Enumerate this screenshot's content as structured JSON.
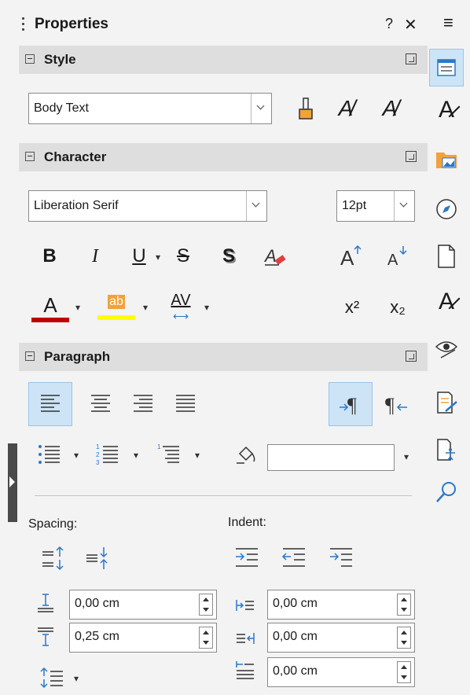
{
  "panel": {
    "title": "Properties",
    "help_label": "?",
    "close_label": "✕",
    "menu_label": "≡"
  },
  "style": {
    "header": "Style",
    "paragraph_style": "Body Text"
  },
  "character": {
    "header": "Character",
    "font_name": "Liberation Serif",
    "font_size": "12pt",
    "bold_label": "B",
    "italic_label": "I",
    "underline_label": "U",
    "strike_label": "S",
    "shadow_label": "S",
    "superscript_label": "x²",
    "subscript_label": "x₂",
    "font_color_label": "A",
    "highlight_label": "ab",
    "spacing_label": "AV",
    "font_color": "#c00000",
    "highlight_color": "#ffff00"
  },
  "paragraph": {
    "header": "Paragraph",
    "spacing_label": "Spacing:",
    "indent_label": "Indent:",
    "above_spacing": "0,00 cm",
    "below_spacing": "0,25 cm",
    "before_indent": "0,00 cm",
    "after_indent": "0,00 cm",
    "first_line_indent": "0,00 cm",
    "list_style": ""
  },
  "colors": {
    "accent": "#2a78c8",
    "selected_bg": "#cde4f7",
    "header_bg": "#dedede",
    "panel_bg": "#f3f3f3"
  }
}
